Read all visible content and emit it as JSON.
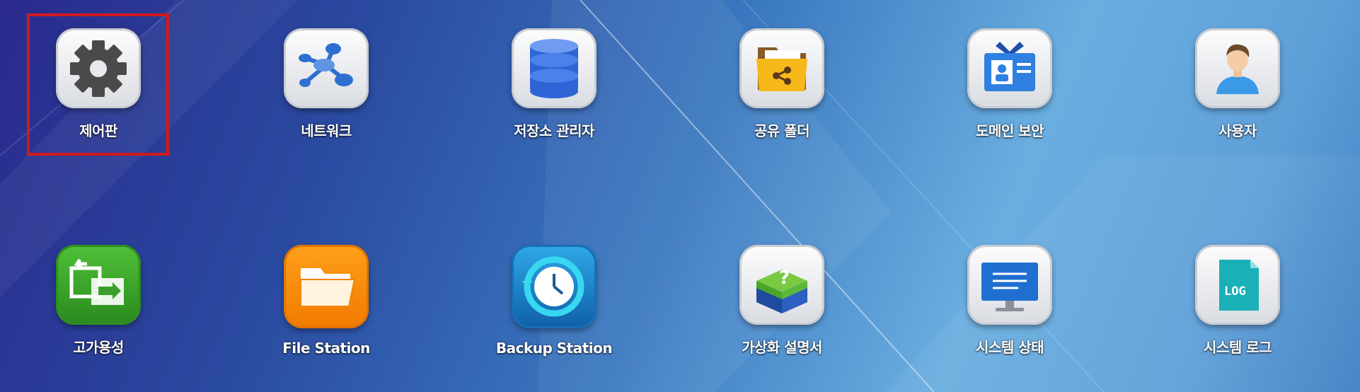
{
  "desktop": {
    "row1": [
      {
        "label": "제어판",
        "icon": "gear-icon"
      },
      {
        "label": "네트워크",
        "icon": "network-icon"
      },
      {
        "label": "저장소 관리자",
        "icon": "database-icon"
      },
      {
        "label": "공유 폴더",
        "icon": "shared-folder-icon"
      },
      {
        "label": "도메인 보안",
        "icon": "id-badge-icon"
      },
      {
        "label": "사용자",
        "icon": "user-icon"
      }
    ],
    "row2": [
      {
        "label": "고가용성",
        "icon": "failover-icon"
      },
      {
        "label": "File Station",
        "icon": "folder-icon"
      },
      {
        "label": "Backup Station",
        "icon": "backup-clock-icon"
      },
      {
        "label": "가상화 설명서",
        "icon": "help-cube-icon"
      },
      {
        "label": "시스템 상태",
        "icon": "monitor-icon"
      },
      {
        "label": "시스템 로그",
        "icon": "log-file-icon"
      }
    ],
    "selected_app": "제어판",
    "selection_color": "#d11a1a"
  }
}
